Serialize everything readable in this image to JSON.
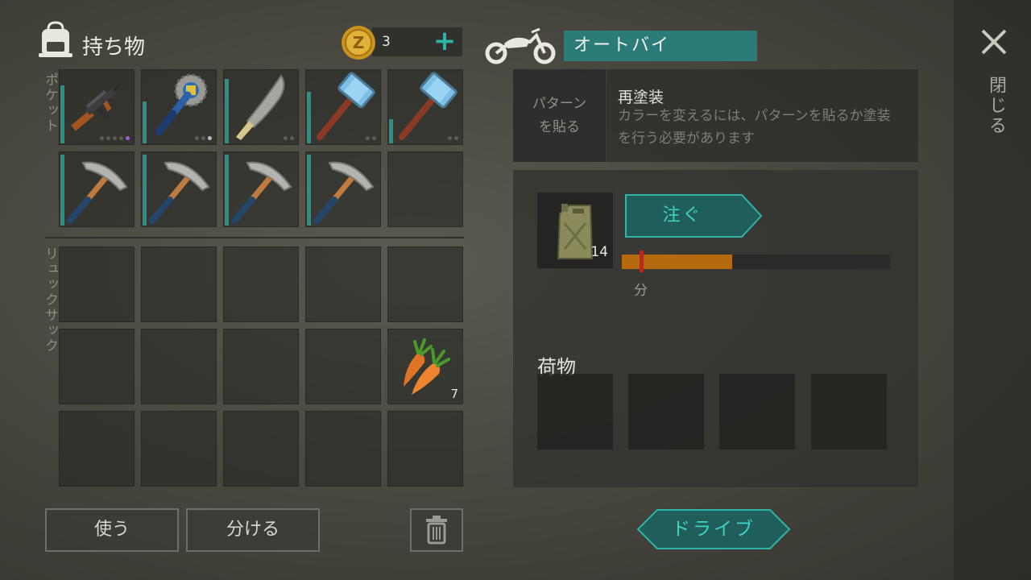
{
  "inventory": {
    "title": "持ち物",
    "coins": "3",
    "pockets_label": "ポケット",
    "backpack_label": "リュックサック",
    "pocket_items": [
      {
        "name": "ak-rifle-icon",
        "durability": 0.95,
        "dots": 4,
        "purple": true
      },
      {
        "name": "saw-mace-icon",
        "durability": 0.85,
        "dots": 3,
        "purple": false
      },
      {
        "name": "machete-icon",
        "durability": 0.9,
        "dots": 2,
        "purple": false
      },
      {
        "name": "sledgehammer-icon",
        "durability": 0.8,
        "dots": 2,
        "purple": false
      },
      {
        "name": "sledgehammer-icon",
        "durability": 0.4,
        "dots": 2,
        "purple": false
      },
      {
        "name": "pickaxe-icon",
        "durability": 0.95
      },
      {
        "name": "pickaxe-icon",
        "durability": 0.95
      },
      {
        "name": "pickaxe-icon",
        "durability": 0.95
      },
      {
        "name": "pickaxe-icon",
        "durability": 0.95
      },
      null
    ],
    "carrot_qty": "7",
    "use_label": "使う",
    "split_label": "分ける"
  },
  "vehicle": {
    "name": "オートバイ",
    "pattern_label_1": "パターン",
    "pattern_label_2": "を貼る",
    "repaint_title": "再塗装",
    "repaint_desc": "カラーを変えるには、パターンを貼るか塗装を行う必要があります",
    "fuel_qty": "14",
    "pour_label": "注ぐ",
    "fuel_level": 0.41,
    "min_label": "分",
    "cargo_title": "荷物",
    "drive_label": "ドライブ"
  },
  "close_label": "閉じる",
  "colors": {
    "accent": "#2fb3a6",
    "vehicle_name_bg": "#2b7c78",
    "fuel": "#b56a10",
    "marker": "#b52c1c"
  }
}
